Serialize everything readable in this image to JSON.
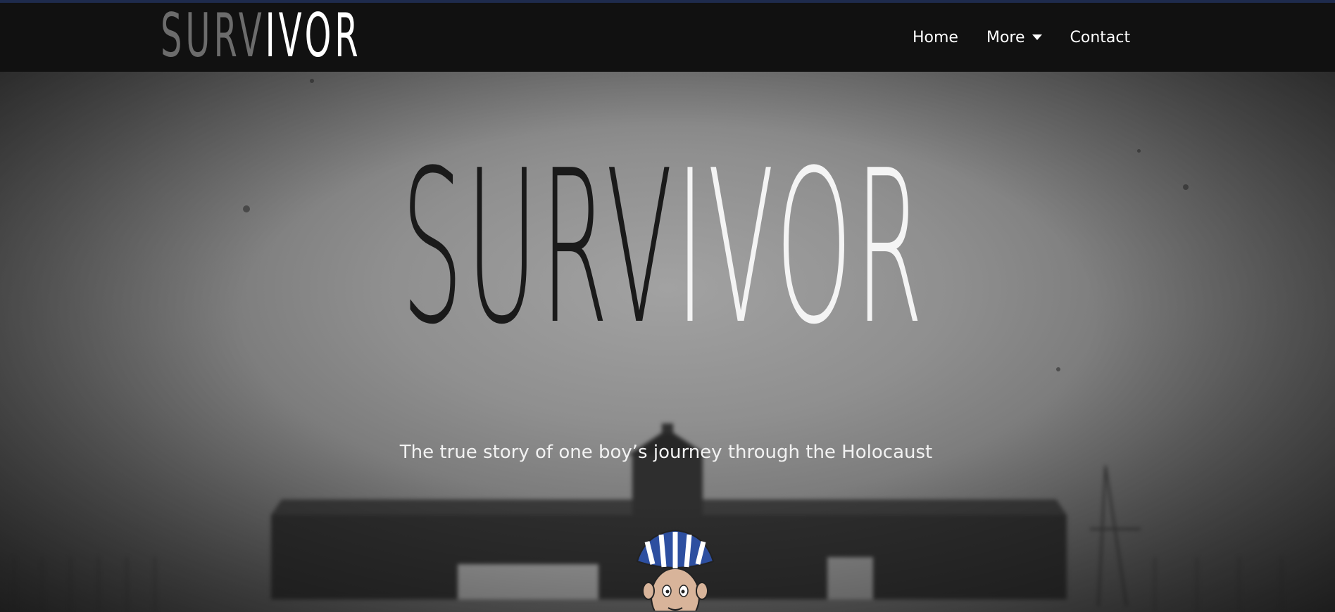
{
  "logo": {
    "part_dim": "SURV",
    "part_bright": "IVOR"
  },
  "nav": {
    "items": [
      {
        "label": "Home",
        "has_dropdown": false
      },
      {
        "label": "More",
        "has_dropdown": true
      },
      {
        "label": "Contact",
        "has_dropdown": false
      }
    ]
  },
  "hero": {
    "title_dark": "SURV",
    "title_light": "IVOR",
    "tagline": "The true story of one boy’s journey through the Holocaust"
  },
  "colors": {
    "nav_bg": "#111111",
    "accent_top": "#1e2b4d",
    "cap_blue": "#2d4fa0"
  }
}
